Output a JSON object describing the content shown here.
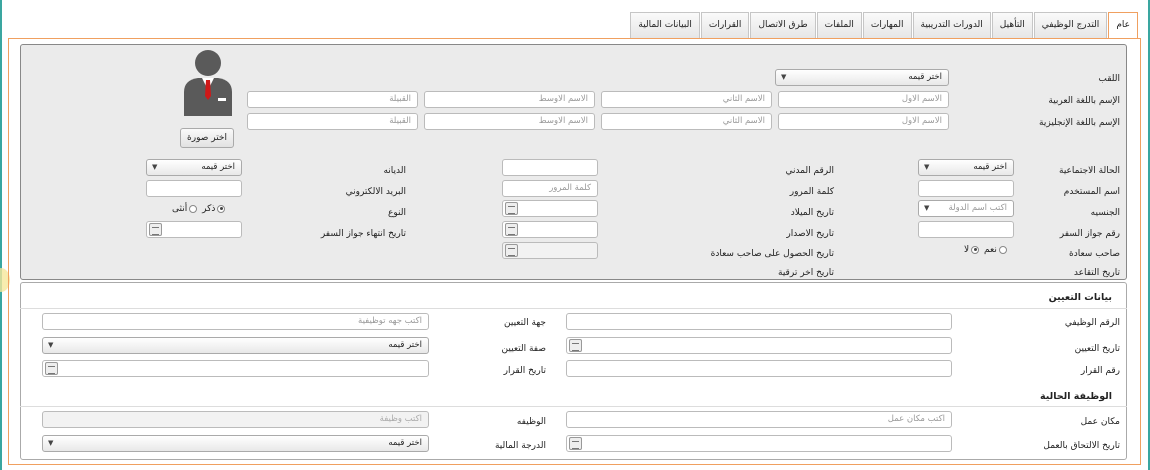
{
  "tabs": [
    {
      "label": "عام",
      "active": true
    },
    {
      "label": "التدرج الوظيفي"
    },
    {
      "label": "التأهيل"
    },
    {
      "label": "الدورات التدريبية"
    },
    {
      "label": "المهارات"
    },
    {
      "label": "الملفات"
    },
    {
      "label": "طرق الاتصال"
    },
    {
      "label": "القرارات"
    },
    {
      "label": "البيانات المالية"
    }
  ],
  "general": {
    "title_label": "اللقب",
    "title_select": "اختر قيمه",
    "arabic_name_label": "الإسم باللغة العربية",
    "english_name_label": "الإسم باللغة الإنجليزية",
    "first_name_ph": "الاسم الاول",
    "second_name_ph": "الاسم الثاني",
    "middle_name_ph": "الاسم الاوسط",
    "tribe_ph": "القبيلة",
    "choose_photo": "اختر صورة",
    "marital_label": "الحالة الاجتماعية",
    "marital_select": "اختر قيمه",
    "username_label": "اسم المستخدم",
    "nationality_label": "الجنسيه",
    "nationality_select": "اكتب اسم الدولة",
    "passport_label": "رقم جواز السفر",
    "excellency_label": "صاحب سعادة",
    "yes": "نعم",
    "no": "لا",
    "retire_label": "تاريخ التقاعد",
    "civil_label": "الرقم المدني",
    "password_label": "كلمة المرور",
    "password_ph": "كلمة المرور",
    "birth_label": "تاريخ الميلاد",
    "issue_label": "تاريخ الاصدار",
    "excellency_date_label": "تاريخ الحصول على صاحب سعادة",
    "last_promo_label": "تاريخ اخر ترقية",
    "religion_label": "الديانه",
    "religion_select": "اختر قيمه",
    "email_label": "البريد الالكتروني",
    "gender_label": "النوع",
    "male": "ذكر",
    "female": "أنثى",
    "passport_exp_label": "تاريخ انتهاء جواز السفر"
  },
  "appointment": {
    "heading": "بيانات التعيين",
    "job_no_label": "الرقم الوظيفي",
    "entity_label": "جهة التعيين",
    "entity_ph": "اكتب جهه توظيفية",
    "appoint_date_label": "تاريخ التعيين",
    "type_label": "صفة التعيين",
    "type_select": "اختر قيمه",
    "decision_no_label": "رقم القرار",
    "decision_date_label": "تاريخ القرار"
  },
  "current_job": {
    "heading": "الوظيفة الحالية",
    "workplace_label": "مكان عمل",
    "workplace_ph": "اكتب مكان عمل",
    "job_label": "الوظيفه",
    "job_ph": "اكتب وظيفة",
    "join_date_label": "تاريخ الالتحاق بالعمل",
    "grade_label": "الدرجة المالية",
    "grade_select": "اختر قيمه"
  }
}
